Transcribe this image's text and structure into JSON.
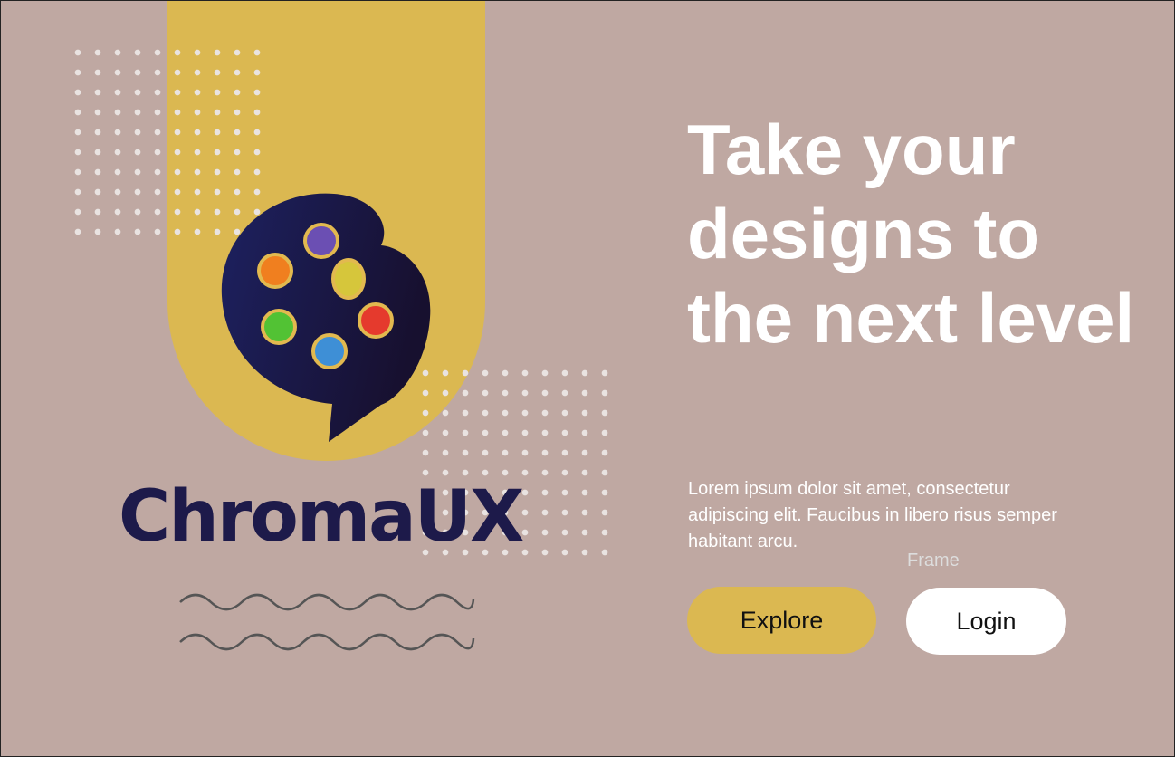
{
  "brand": {
    "name": "ChromaUX",
    "colors": {
      "background": "#bfa8a2",
      "accent": "#dbb851",
      "navy": "#1d1a4a",
      "white": "#ffffff"
    },
    "logo_icon": "palette-speech-bubble-icon"
  },
  "hero": {
    "headline": "Take your designs to the next level",
    "description": "Lorem ipsum dolor sit amet, consectetur adipiscing elit. Faucibus in libero risus semper habitant arcu."
  },
  "frame_label": "Frame",
  "buttons": {
    "explore": "Explore",
    "login": "Login"
  },
  "palette_paint_colors": [
    "#6b4fb3",
    "#f07f1f",
    "#d6c63b",
    "#e53a2d",
    "#52c234",
    "#3e8fd6"
  ]
}
